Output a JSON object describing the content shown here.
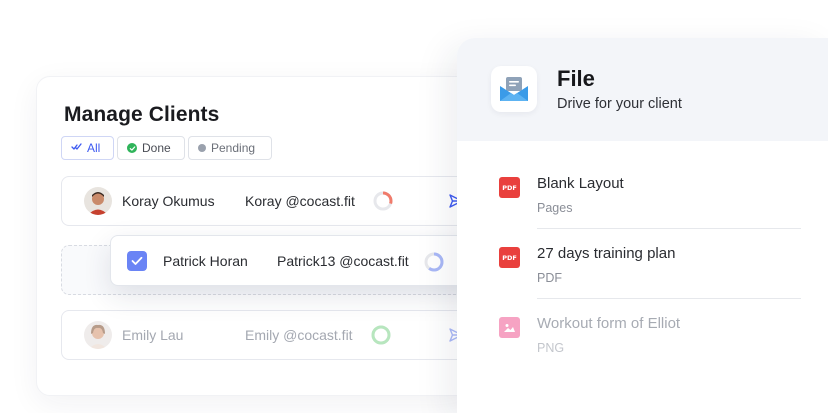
{
  "clients": {
    "title": "Manage Clients",
    "filters": [
      {
        "label": "All",
        "selected": true
      },
      {
        "label": "Done",
        "selected": false
      },
      {
        "label": "Pending",
        "selected": false
      }
    ],
    "rows": [
      {
        "name": "Koray Okumus",
        "handle": "Koray @cocast.fit",
        "progress": 0.3,
        "progress_color": "#f07b6b"
      },
      {
        "name": "Patrick Horan",
        "handle": "Patrick13 @cocast.fit",
        "progress": 0.6,
        "progress_color": "#a9b8f7",
        "checked": true
      },
      {
        "name": "Emily Lau",
        "handle": "Emily @cocast.fit",
        "progress": 1.0,
        "progress_color": "#b7e6be"
      }
    ]
  },
  "file": {
    "title": "File",
    "subtitle": "Drive for your client",
    "items": [
      {
        "name": "Blank Layout",
        "type": "Pages",
        "icon": "pdf-icon",
        "badge": "PDF"
      },
      {
        "name": "27 days training plan",
        "type": "PDF",
        "icon": "pdf-icon",
        "badge": "PDF"
      },
      {
        "name": "Workout form of Elliot",
        "type": "PNG",
        "icon": "image-icon"
      }
    ]
  },
  "colors": {
    "accent": "#3d5af1",
    "done_green": "#2fb45a",
    "pdf_red": "#e9403d",
    "image_pink": "#f6a3c3",
    "header_bg": "#f3f5f9"
  }
}
